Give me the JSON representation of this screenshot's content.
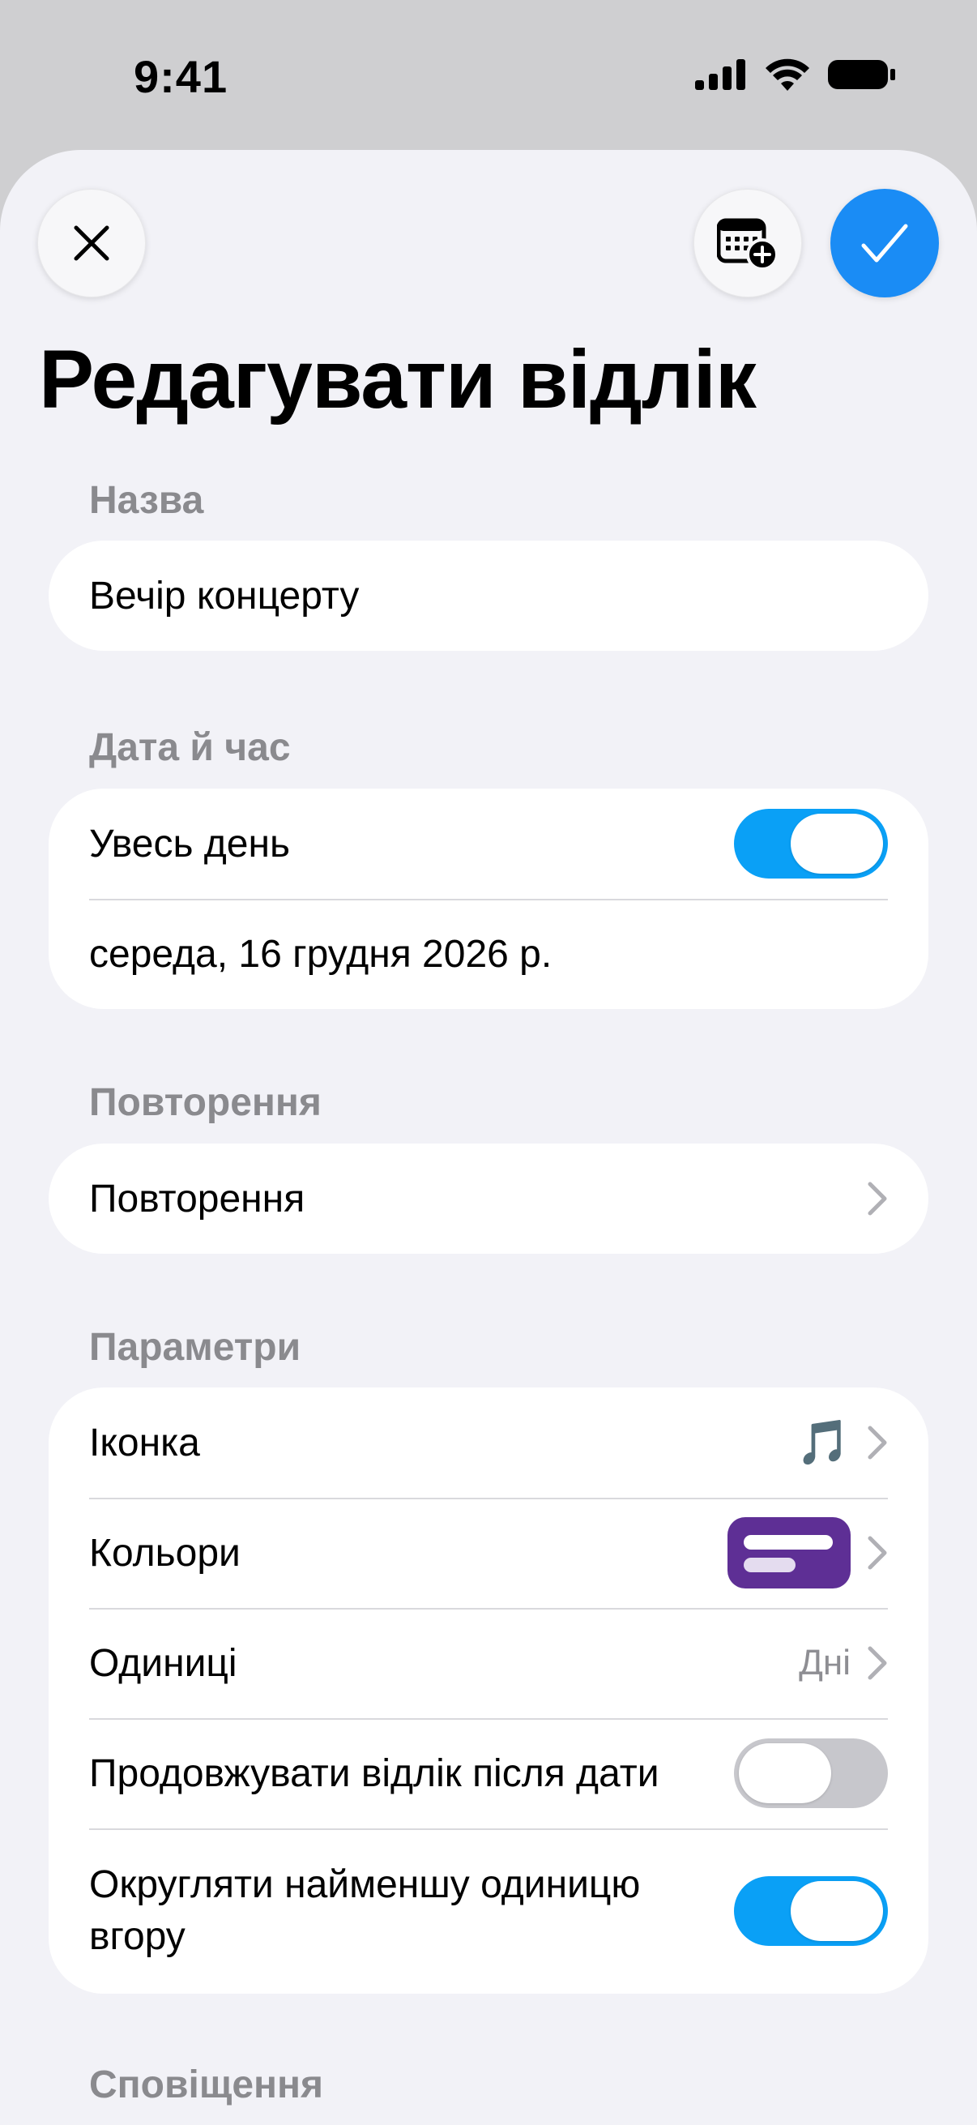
{
  "status_bar": {
    "time": "9:41",
    "icons": [
      "cellular-signal-icon",
      "wifi-icon",
      "battery-icon"
    ]
  },
  "header": {
    "close_icon": "close-icon",
    "calendar_icon": "calendar-add-icon",
    "confirm_icon": "checkmark-icon",
    "title": "Редагувати відлік"
  },
  "name_section": {
    "label": "Назва",
    "value": "Вечір концерту"
  },
  "datetime_section": {
    "label": "Дата й час",
    "all_day_label": "Увесь день",
    "all_day_on": true,
    "date_value": "середа, 16 грудня 2026 р."
  },
  "repeat_section": {
    "label": "Повторення",
    "row_label": "Повторення"
  },
  "params_section": {
    "label": "Параметри",
    "icon_label": "Іконка",
    "icon_value": "🎵",
    "colors_label": "Кольори",
    "color_accent": "#5e2f95",
    "units_label": "Одиниці",
    "units_value": "Дні",
    "continue_label": "Продовжувати відлік після дати",
    "continue_on": false,
    "round_label": "Округляти найменшу одиницю вгору",
    "round_on": true
  },
  "notifications_section": {
    "label": "Сповіщення"
  },
  "colors": {
    "accent_blue": "#1a8cf5",
    "toggle_on": "#0aa0f6"
  }
}
